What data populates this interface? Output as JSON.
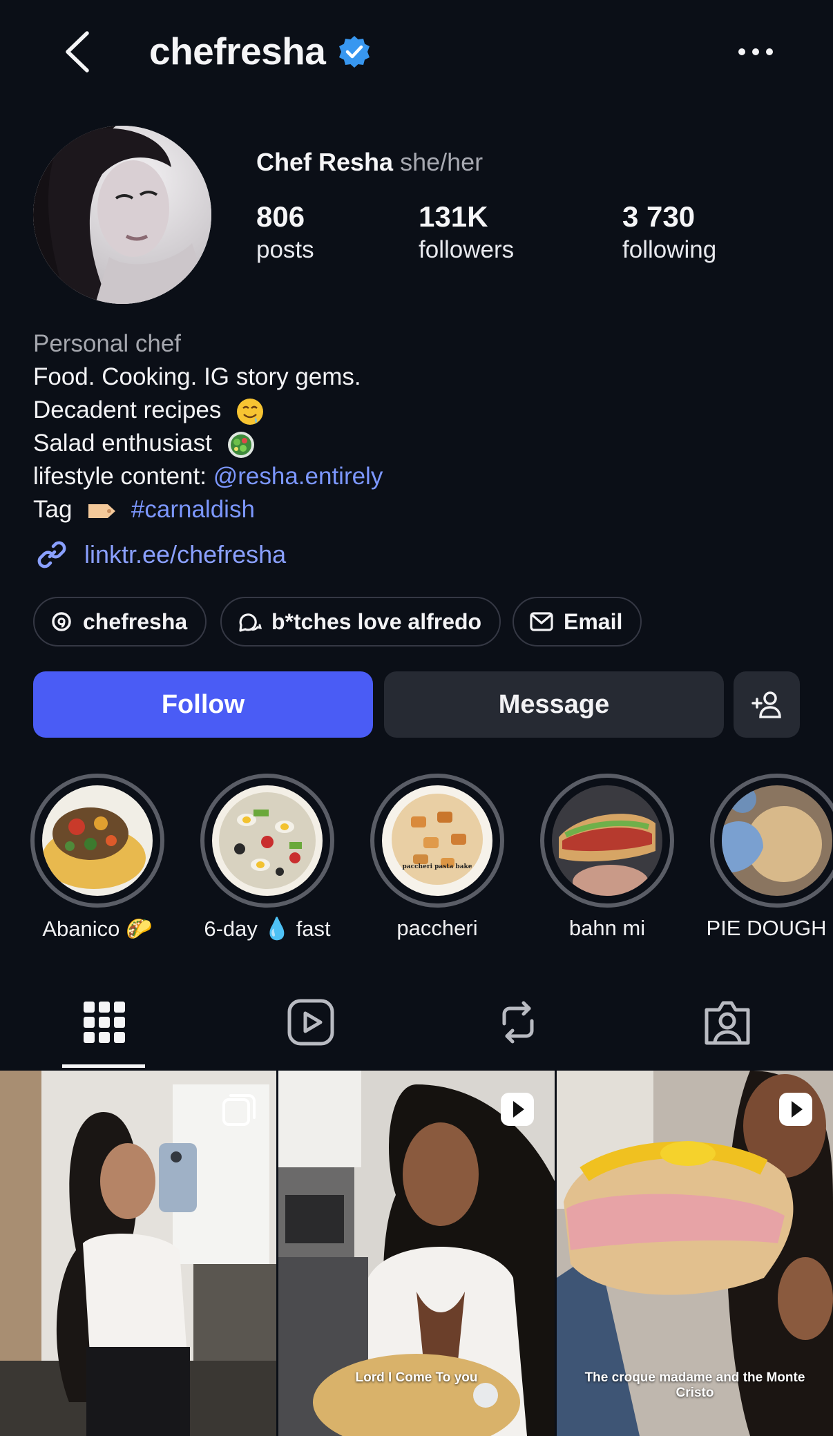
{
  "header": {
    "handle": "chefresha",
    "verified": true
  },
  "profile": {
    "name": "Chef Resha",
    "pronouns": "she/her",
    "stats": [
      {
        "value": "806",
        "label": "posts"
      },
      {
        "value": "131K",
        "label": "followers"
      },
      {
        "value": "3 730",
        "label": "following"
      }
    ]
  },
  "bio": {
    "category": "Personal chef",
    "line1": "Food. Cooking. IG story gems.",
    "line2": "Decadent recipes",
    "line3": "Salad enthusiast",
    "line4_prefix": "lifestyle content: ",
    "line4_link": "@resha.entirely",
    "line5_prefix": "Tag",
    "line5_link": "#carnaldish",
    "link": "linktr.ee/chefresha"
  },
  "chips": [
    {
      "label": "chefresha",
      "icon": "threads-icon"
    },
    {
      "label": "b*tches love alfredo",
      "icon": "chat-icon"
    },
    {
      "label": "Email",
      "icon": "mail-icon"
    }
  ],
  "actions": {
    "follow": "Follow",
    "message": "Message",
    "add_user_icon": "add-person-icon"
  },
  "highlights": [
    {
      "label": "Abanico 🌮"
    },
    {
      "label": "6-day 💧 fast"
    },
    {
      "label": "paccheri",
      "image_text": "paccheri pasta bake"
    },
    {
      "label": "bahn mi"
    },
    {
      "label": "PIE DOUGH D"
    }
  ],
  "tabs": [
    "grid-icon",
    "reels-icon",
    "reposts-icon",
    "tagged-icon"
  ],
  "posts": [
    {
      "type": "carousel",
      "caption": ""
    },
    {
      "type": "reel",
      "caption": "Lord I Come To you"
    },
    {
      "type": "reel",
      "caption": "The croque madame and the Monte Cristo"
    }
  ],
  "colors": {
    "background": "#0b0f17",
    "follow_button": "#4a5cf5",
    "secondary_button": "#262a33",
    "link": "#7c97ff",
    "verified": "#3897f0"
  }
}
